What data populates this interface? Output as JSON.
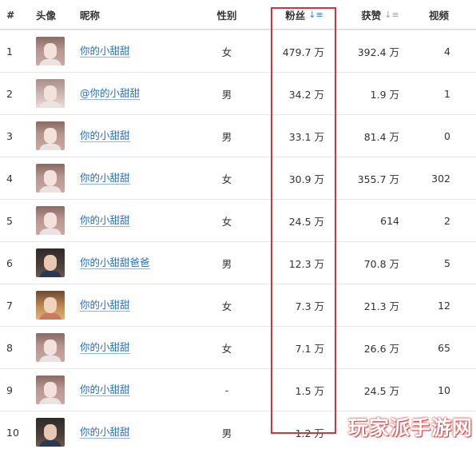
{
  "headers": {
    "index": "#",
    "avatar": "头像",
    "nickname": "昵称",
    "gender": "性别",
    "fans": "粉丝",
    "likes": "获赞",
    "videos": "视频"
  },
  "rows": [
    {
      "index": "1",
      "nickname": "你的小甜甜",
      "gender": "女",
      "fans": "479.7 万",
      "likes": "392.4 万",
      "videos": "4"
    },
    {
      "index": "2",
      "nickname": "@你的小甜甜",
      "gender": "男",
      "fans": "34.2 万",
      "likes": "1.9 万",
      "videos": "1"
    },
    {
      "index": "3",
      "nickname": "你的小甜甜",
      "gender": "男",
      "fans": "33.1 万",
      "likes": "81.4 万",
      "videos": "0"
    },
    {
      "index": "4",
      "nickname": "你的小甜甜",
      "gender": "女",
      "fans": "30.9 万",
      "likes": "355.7 万",
      "videos": "302"
    },
    {
      "index": "5",
      "nickname": "你的小甜甜",
      "gender": "女",
      "fans": "24.5 万",
      "likes": "614",
      "videos": "2"
    },
    {
      "index": "6",
      "nickname": "你的小甜甜爸爸",
      "gender": "男",
      "fans": "12.3 万",
      "likes": "70.8 万",
      "videos": "5"
    },
    {
      "index": "7",
      "nickname": "你的小甜甜",
      "gender": "女",
      "fans": "7.3 万",
      "likes": "21.3 万",
      "videos": "12"
    },
    {
      "index": "8",
      "nickname": "你的小甜甜",
      "gender": "女",
      "fans": "7.1 万",
      "likes": "26.6 万",
      "videos": "65"
    },
    {
      "index": "9",
      "nickname": "你的小甜甜",
      "gender": "-",
      "fans": "1.5 万",
      "likes": "24.5 万",
      "videos": "10"
    },
    {
      "index": "10",
      "nickname": "你的小甜甜",
      "gender": "男",
      "fans": "1.2 万",
      "likes": "",
      "videos": ""
    }
  ],
  "watermark": "玩家派手游网",
  "colors": {
    "link": "#2a6ebb",
    "highlight": "#d7333b",
    "sort_active": "#3a7bd5"
  }
}
